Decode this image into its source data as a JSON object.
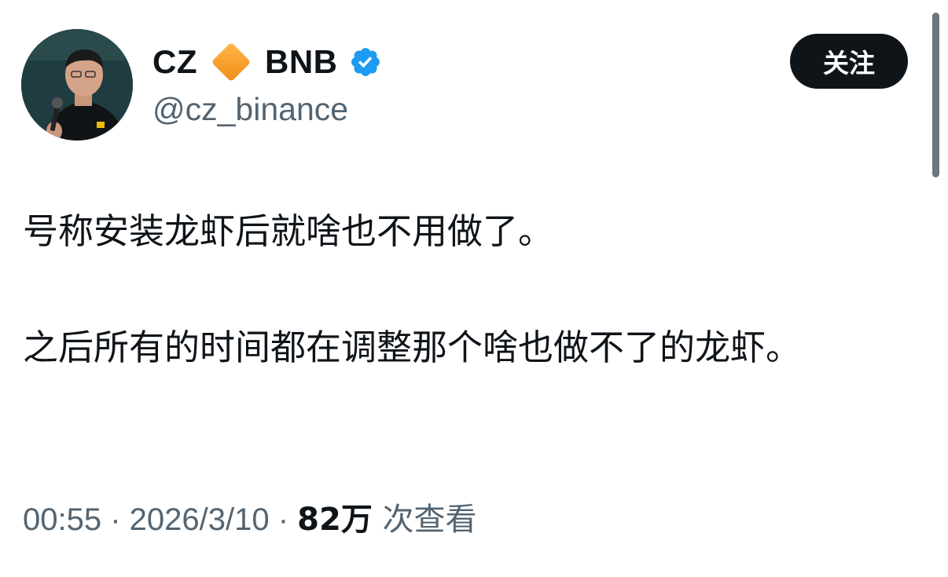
{
  "author": {
    "display_name_part1": "CZ",
    "display_name_part2": "BNB",
    "handle": "@cz_binance",
    "diamond_icon": "orange-diamond-icon",
    "verified_icon": "verified-badge-icon",
    "verified_color": "#1d9bf0",
    "diamond_color": "#f5a623"
  },
  "follow_button": {
    "label": "关注"
  },
  "tweet": {
    "text": "号称安装龙虾后就啥也不用做了。\n\n之后所有的时间都在调整那个啥也做不了的龙虾。"
  },
  "meta": {
    "time": "00:55",
    "separator": " · ",
    "date": "2026/3/10",
    "views_count": "82万",
    "views_label": " 次查看"
  }
}
